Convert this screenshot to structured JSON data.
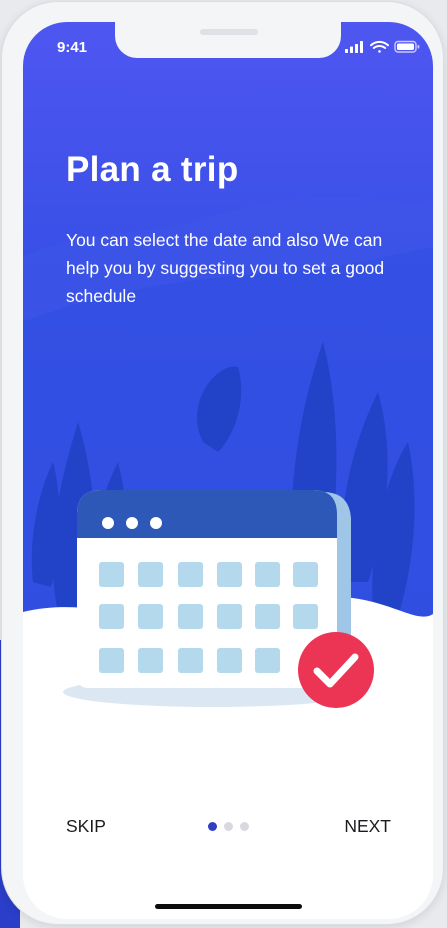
{
  "status_bar": {
    "time": "9:41",
    "icons": [
      "signal-icon",
      "wifi-icon",
      "battery-icon"
    ]
  },
  "onboarding": {
    "title": "Plan a trip",
    "description": "You can select the date and also We can help you by suggesting you to set a good schedule",
    "illustration": {
      "icons": [
        "calendar-icon",
        "checkmark-badge-icon"
      ]
    }
  },
  "navigation": {
    "skip_label": "SKIP",
    "next_label": "NEXT",
    "page_count": 3,
    "current_page": 1
  },
  "colors": {
    "hero_top": "#4f56f1",
    "hero_bottom": "#1f47d6",
    "calendar_header": "#2d58b8",
    "calendar_cell": "#b4d8ec",
    "check_badge": "#ec3455",
    "active_dot": "#2f3fc4",
    "inactive_dot": "#d7d9de"
  }
}
